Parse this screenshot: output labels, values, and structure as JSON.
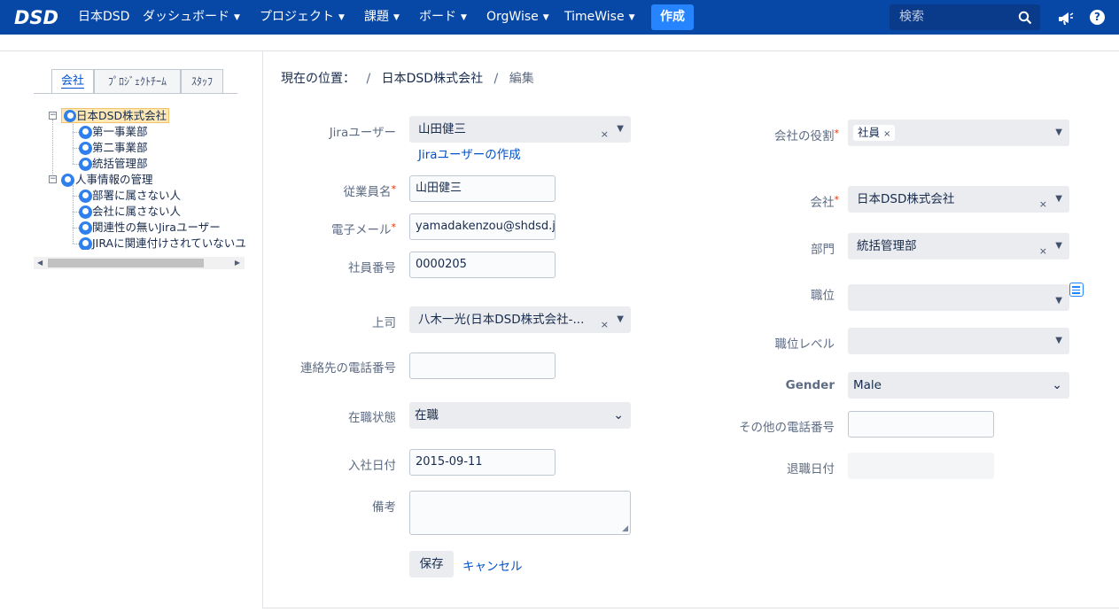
{
  "nav": {
    "logo_text": "DSD",
    "site_name": "日本DSD",
    "items": [
      {
        "label": "ダッシュボード"
      },
      {
        "label": "プロジェクト"
      },
      {
        "label": "課題"
      },
      {
        "label": "ボード"
      },
      {
        "label": "OrgWise"
      },
      {
        "label": "TimeWise"
      }
    ],
    "create_label": "作成",
    "search_placeholder": "検索",
    "help_label": "?"
  },
  "sidebar": {
    "tabs": [
      {
        "label": "会社"
      },
      {
        "label": "ﾌﾟﾛｼﾞｪｸﾄﾁｰﾑ"
      },
      {
        "label": "ｽﾀｯﾌ"
      }
    ],
    "tree": {
      "company": "日本DSD株式会社",
      "departments": [
        "第一事業部",
        "第二事業部",
        "統括管理部"
      ],
      "hr_root": "人事情報の管理",
      "hr_items": [
        "部署に属さない人",
        "会社に属さない人",
        "関連性の無いJiraユーザー",
        "JIRAに関連付けされていないユ"
      ]
    }
  },
  "breadcrumb": {
    "prefix": "現在の位置：",
    "company": "日本DSD株式会社",
    "current": "編集"
  },
  "form": {
    "jira_user": {
      "label": "Jiraユーザー",
      "value": "山田健三",
      "create_link": "Jiraユーザーの作成"
    },
    "employee_name": {
      "label": "従業員名",
      "value": "山田健三"
    },
    "email": {
      "label": "電子メール",
      "value": "yamadakenzou@shdsd.jp"
    },
    "employee_no": {
      "label": "社員番号",
      "value": "0000205"
    },
    "manager": {
      "label": "上司",
      "value": "八木一光(日本DSD株式会社-..."
    },
    "contact_phone": {
      "label": "連絡先の電話番号",
      "value": ""
    },
    "employment_status": {
      "label": "在職状態",
      "value": "在職"
    },
    "join_date": {
      "label": "入社日付",
      "value": "2015-09-11"
    },
    "remarks": {
      "label": "備考",
      "value": ""
    },
    "company_role": {
      "label": "会社の役割",
      "tag": "社員"
    },
    "company": {
      "label": "会社",
      "value": "日本DSD株式会社"
    },
    "department": {
      "label": "部門",
      "value": "統括管理部"
    },
    "position": {
      "label": "職位",
      "value": ""
    },
    "position_level": {
      "label": "職位レベル",
      "value": ""
    },
    "gender": {
      "label": "Gender",
      "value": "Male"
    },
    "other_phone": {
      "label": "その他の電話番号",
      "value": ""
    },
    "retire_date": {
      "label": "退職日付",
      "value": ""
    },
    "required_mark": "*",
    "clear_mark": "×",
    "save_label": "保存",
    "cancel_label": "キャンセル"
  }
}
